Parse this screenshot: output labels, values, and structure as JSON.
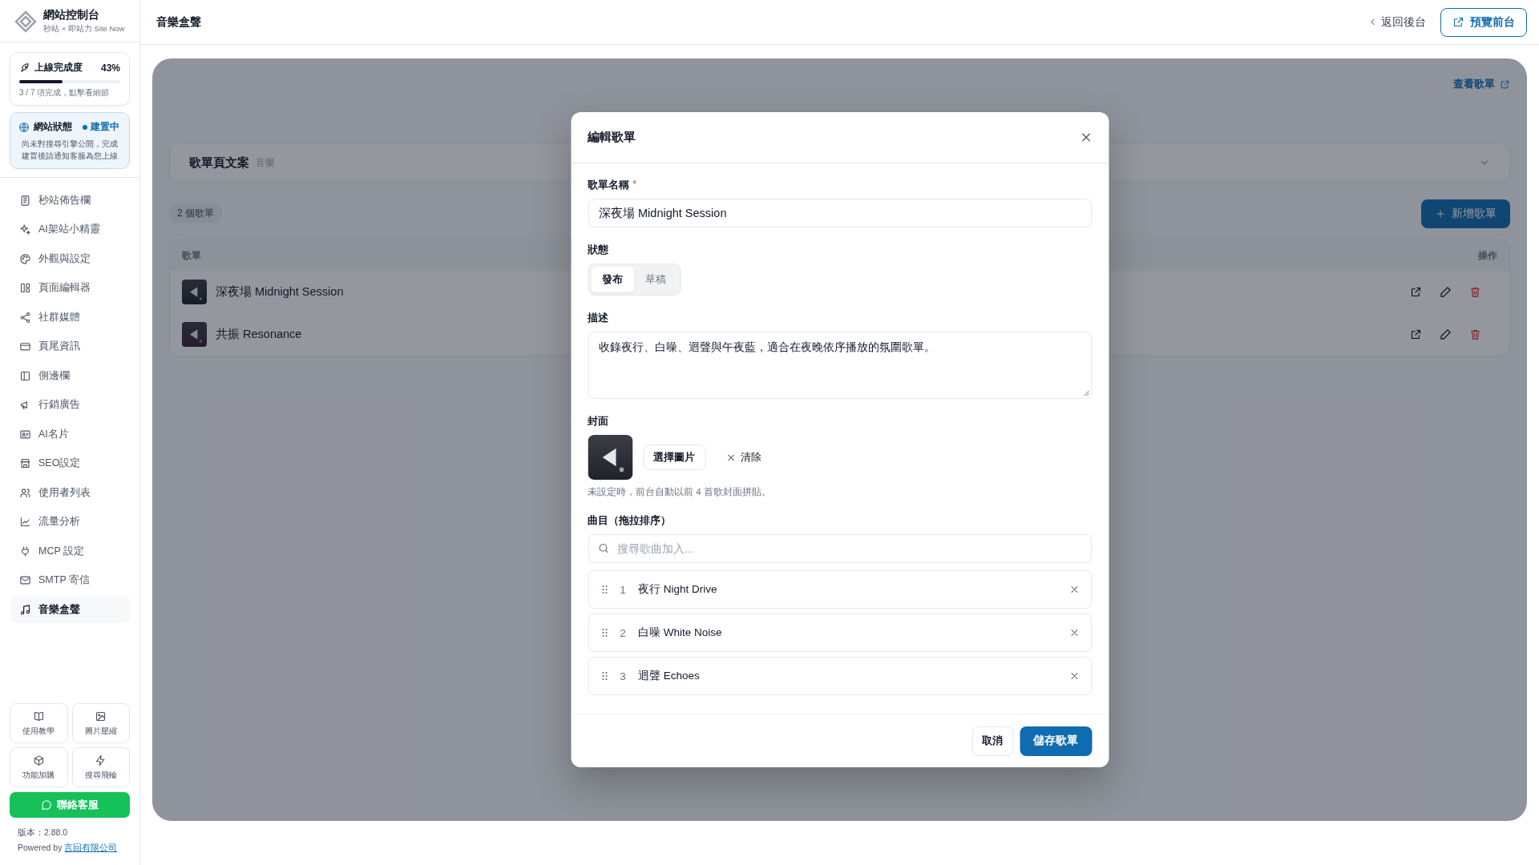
{
  "sidebar": {
    "brand": {
      "title": "網站控制台",
      "subtitle": "秒站 × 即站力 Site Now"
    },
    "progress": {
      "label": "上線完成度",
      "percent": "43%",
      "level": 0.43,
      "detail": "3 / 7 項完成，點擊看細節"
    },
    "site_status": {
      "label": "網站狀態",
      "status": "建置中",
      "note": "尚未對搜尋引擎公開，完成建置後請通知客服為您上線"
    },
    "nav_items": [
      {
        "label": "秒站佈告欄",
        "selected": false
      },
      {
        "label": "AI架站小精靈",
        "selected": false
      },
      {
        "label": "外觀與設定",
        "selected": false
      },
      {
        "label": "頁面編輯器",
        "selected": false
      },
      {
        "label": "社群媒體",
        "selected": false
      },
      {
        "label": "頁尾資訊",
        "selected": false
      },
      {
        "label": "側邊欄",
        "selected": false
      },
      {
        "label": "行銷廣告",
        "selected": false
      },
      {
        "label": "AI名片",
        "selected": false
      },
      {
        "label": "SEO設定",
        "selected": false
      },
      {
        "label": "使用者列表",
        "selected": false
      },
      {
        "label": "流量分析",
        "selected": false
      },
      {
        "label": "MCP 設定",
        "selected": false
      },
      {
        "label": "SMTP 寄信",
        "selected": false
      },
      {
        "label": "音樂盒聲",
        "selected": true
      }
    ],
    "tiles": [
      {
        "label": "使用教學"
      },
      {
        "label": "圖片壓縮"
      },
      {
        "label": "功能加購"
      },
      {
        "label": "搜尋飛輪"
      }
    ],
    "contact_button": "聯絡客服",
    "version": "版本：2.88.0",
    "powered_by": "Powered by",
    "company_link": "言回有限公司"
  },
  "header": {
    "title": "音樂盒聲",
    "back_link": "返回後台",
    "preview_button": "預覽前台"
  },
  "page": {
    "view_link": "查看歌單",
    "section_title": "歌單頁文案",
    "section_tag": "音樂",
    "count_badge": "2 個歌單",
    "add_button": "新增歌單",
    "table": {
      "columns": [
        "歌單",
        "操作"
      ],
      "rows": [
        {
          "title": "深夜場 Midnight Session"
        },
        {
          "title": "共振 Resonance"
        }
      ]
    }
  },
  "modal": {
    "title": "編輯歌單",
    "name_label": "歌單名稱",
    "required_mark": "*",
    "name_value": "深夜場 Midnight Session",
    "status_label": "狀態",
    "status_options": [
      {
        "label": "發布",
        "selected": true
      },
      {
        "label": "草稿",
        "selected": false
      }
    ],
    "description_label": "描述",
    "description_value": "收錄夜行、白噪、迴聲與午夜藍，適合在夜晚依序播放的氛圍歌單。",
    "cover_label": "封面",
    "choose_button": "選擇圖片",
    "clear_button": "清除",
    "cover_hint": "未設定時，前台自動以前 4 首歌封面拼貼。",
    "tracks_label": "曲目（拖拉排序）",
    "search_placeholder": "搜尋歌曲加入...",
    "tracks": [
      {
        "number": "1",
        "title": "夜行 Night Drive"
      },
      {
        "number": "2",
        "title": "白噪 White Noise"
      },
      {
        "number": "3",
        "title": "迴聲 Echoes"
      }
    ],
    "cancel_button": "取消",
    "save_button": "儲存歌單"
  }
}
